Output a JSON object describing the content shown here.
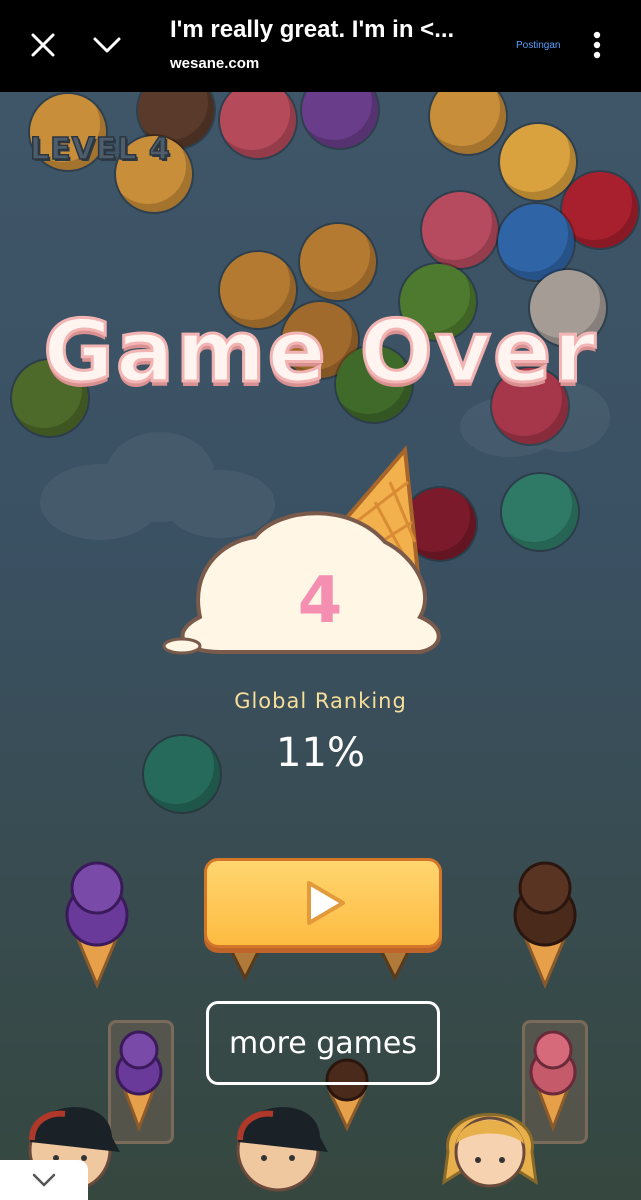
{
  "browser_bar": {
    "title": "I'm really great. I'm in <...",
    "domain": "wesane.com",
    "post_label": "Postingan",
    "icons": [
      "close-icon",
      "chevron-down-icon",
      "more-vert-icon"
    ]
  },
  "game": {
    "level_label": "LEVEL 4",
    "game_over": "Game Over",
    "score": "4",
    "global_ranking_label": "Global Ranking",
    "global_ranking_value": "11%",
    "play_icon": "play-icon",
    "more_games_label": "more games",
    "colors": {
      "play_button": "#fdbb41",
      "game_over_text": "#fff4f0",
      "ranking_label": "#f6df9a"
    }
  },
  "bottom_tab": {
    "icon": "chevron-down-icon"
  }
}
